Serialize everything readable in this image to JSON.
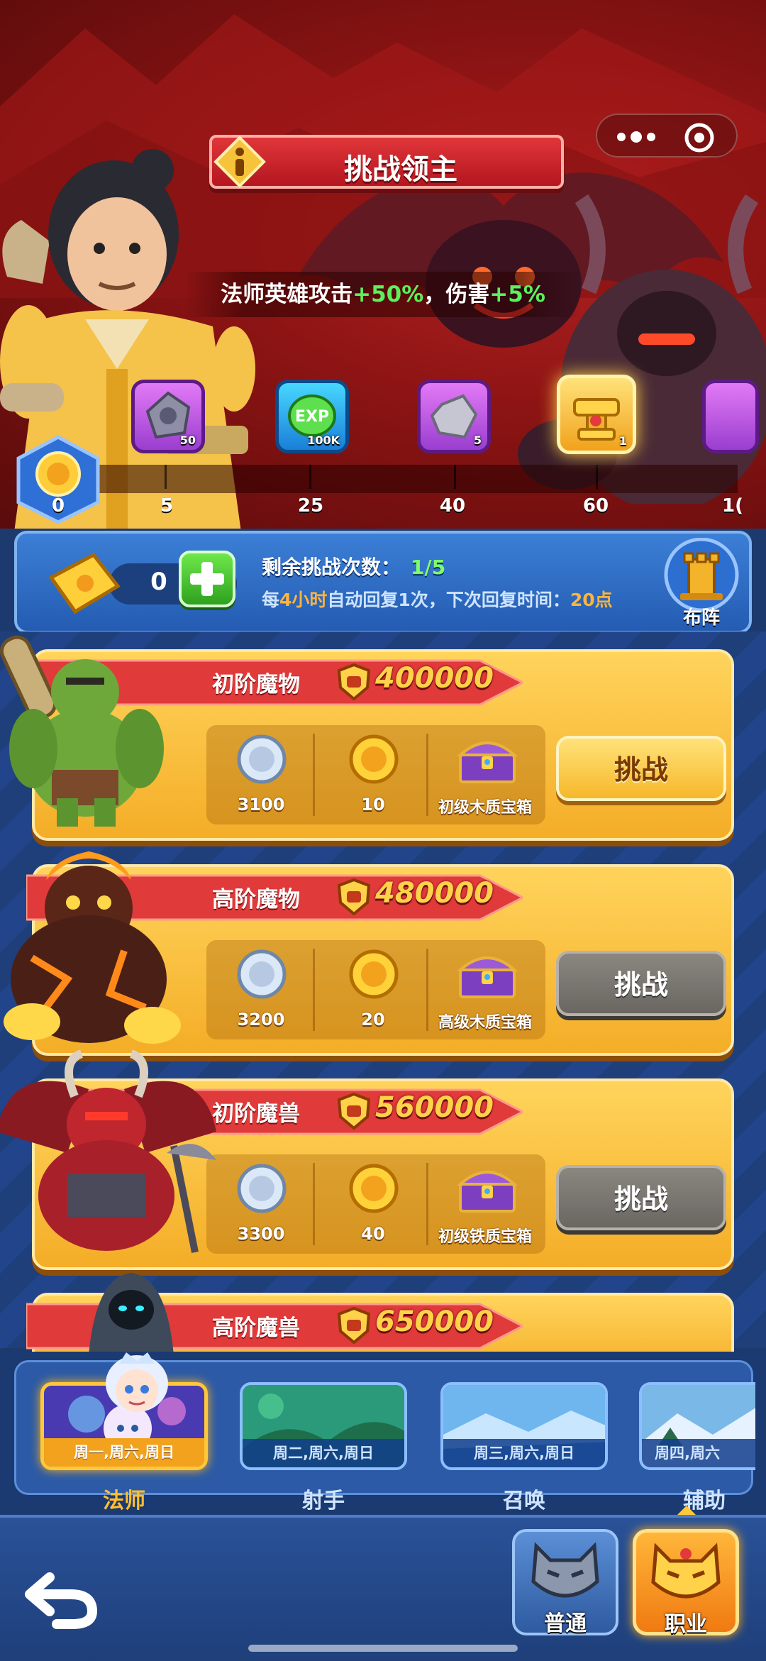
{
  "header": {
    "title": "挑战领主",
    "buff_prefix": "法师英雄攻击",
    "buff_attack": "+50%",
    "buff_mid": "，伤害",
    "buff_damage": "+5%"
  },
  "progress": {
    "start_value": "0",
    "rewards": [
      {
        "icon": "purple-ore-icon",
        "qty": "50"
      },
      {
        "icon": "exp-gem-icon",
        "qty": "100K"
      },
      {
        "icon": "silver-ore-icon",
        "qty": "5"
      },
      {
        "icon": "gold-anvil-icon",
        "qty": "1"
      }
    ],
    "milestones": [
      "5",
      "25",
      "40",
      "60",
      "1("
    ]
  },
  "attempts": {
    "ticket_count": "0",
    "label": "剩余挑战次数：",
    "value": "1/5",
    "recover_prefix": "每",
    "recover_interval": "4小时",
    "recover_mid": "自动回复1次，下次回复时间：",
    "recover_time": "20点",
    "formation_label": "布阵"
  },
  "monsters": [
    {
      "name": "初阶魔物",
      "power": "400000",
      "rewards": [
        {
          "icon": "silver-coin-icon",
          "label": "3100"
        },
        {
          "icon": "gold-coin-icon",
          "label": "10"
        },
        {
          "icon": "treasure-chest-icon",
          "label": "初级木质宝箱"
        }
      ],
      "button": "挑战",
      "state": "active"
    },
    {
      "name": "高阶魔物",
      "power": "480000",
      "rewards": [
        {
          "icon": "silver-coin-icon",
          "label": "3200"
        },
        {
          "icon": "gold-coin-icon",
          "label": "20"
        },
        {
          "icon": "treasure-chest-icon",
          "label": "高级木质宝箱"
        }
      ],
      "button": "挑战",
      "state": "locked"
    },
    {
      "name": "初阶魔兽",
      "power": "560000",
      "rewards": [
        {
          "icon": "silver-coin-icon",
          "label": "3300"
        },
        {
          "icon": "gold-coin-icon",
          "label": "40"
        },
        {
          "icon": "treasure-chest-icon",
          "label": "初级铁质宝箱"
        }
      ],
      "button": "挑战",
      "state": "locked"
    },
    {
      "name": "高阶魔兽",
      "power": "650000"
    }
  ],
  "categories": [
    {
      "days": "周一,周六,周日",
      "label": "法师",
      "selected": true
    },
    {
      "days": "周二,周六,周日",
      "label": "射手",
      "selected": false
    },
    {
      "days": "周三,周六,周日",
      "label": "召唤",
      "selected": false
    },
    {
      "days": "周四,周六",
      "label": "辅助",
      "selected": false
    }
  ],
  "bottom_nav": {
    "normal_label": "普通",
    "career_label": "职业"
  },
  "colors": {
    "hero_red": "#b32222",
    "card_gold": "#f4ad27",
    "panel_blue": "#2c5aa6",
    "green_text": "#5cf05c",
    "accent_orange": "#ffb43a"
  }
}
